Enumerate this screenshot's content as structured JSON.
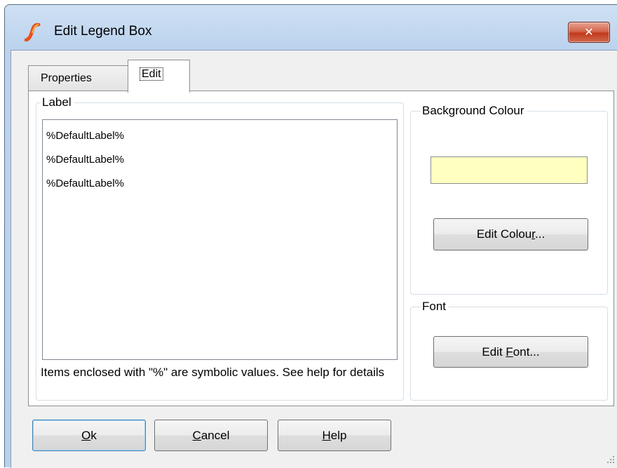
{
  "window": {
    "title": "Edit Legend Box",
    "close_glyph": "✕",
    "icon": "simetrix-s-icon"
  },
  "tabs": [
    {
      "label": "Properties",
      "selected": false
    },
    {
      "label": "Edit",
      "selected": true
    }
  ],
  "label_group": {
    "title": "Label",
    "items": [
      "%DefaultLabel%",
      "%DefaultLabel%",
      "%DefaultLabel%"
    ],
    "hint": "Items enclosed with \"%\" are symbolic values. See help for details"
  },
  "background_group": {
    "title": "Background Colour",
    "swatch_color": "#ffffc0",
    "edit_button": {
      "pre": "Edit Colou",
      "mnemonic": "r",
      "post": "..."
    }
  },
  "font_group": {
    "title": "Font",
    "edit_button": {
      "pre": "Edit ",
      "mnemonic": "F",
      "post": "ont..."
    }
  },
  "footer": {
    "ok": {
      "pre": "",
      "mnemonic": "O",
      "post": "k"
    },
    "cancel": {
      "pre": "",
      "mnemonic": "C",
      "post": "ancel"
    },
    "help": {
      "pre": "",
      "mnemonic": "H",
      "post": "elp"
    }
  }
}
